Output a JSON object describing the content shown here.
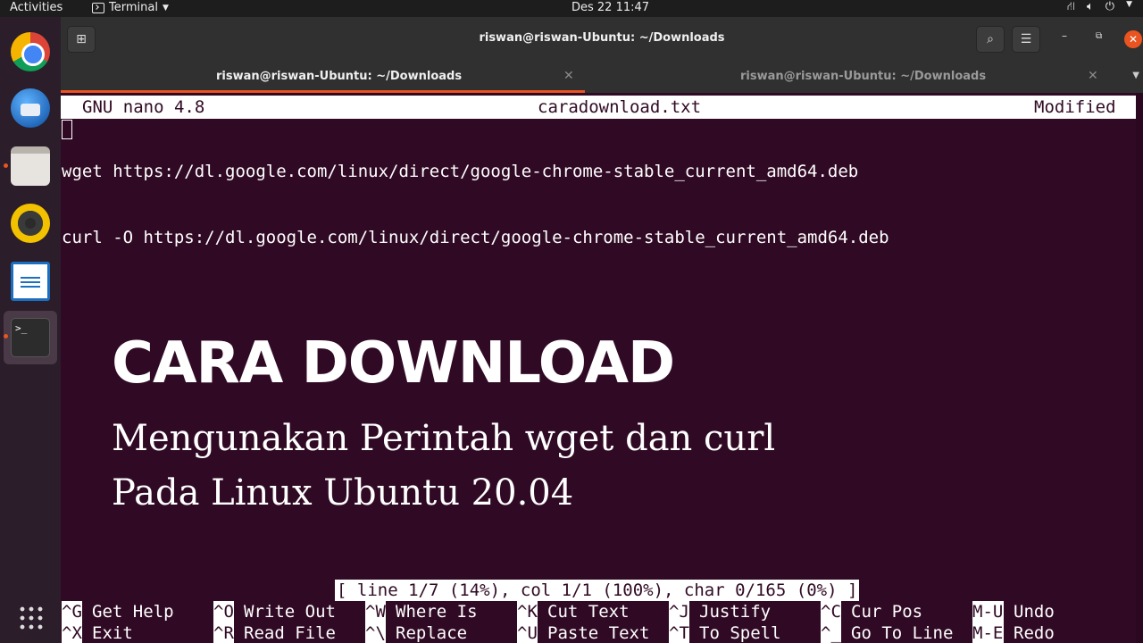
{
  "topbar": {
    "activities": "Activities",
    "app_menu": "Terminal",
    "clock": "Des 22  11:47",
    "tray_icons": [
      "network-icon",
      "volume-icon",
      "power-icon",
      "menu-caret-icon"
    ]
  },
  "dock": {
    "apps": [
      "chrome-icon",
      "thunderbird-icon",
      "files-icon",
      "rhythmbox-icon",
      "writer-icon",
      "terminal-icon"
    ],
    "terminal_glyph": ">_"
  },
  "window": {
    "title": "riswan@riswan-Ubuntu: ~/Downloads",
    "tabs": [
      {
        "label": "riswan@riswan-Ubuntu: ~/Downloads",
        "active": true
      },
      {
        "label": "riswan@riswan-Ubuntu: ~/Downloads",
        "active": false
      }
    ]
  },
  "nano": {
    "version": "GNU nano 4.8",
    "filename": "caradownload.txt",
    "state": "Modified",
    "lines": [
      "wget https://dl.google.com/linux/direct/google-chrome-stable_current_amd64.deb",
      "curl -O https://dl.google.com/linux/direct/google-chrome-stable_current_amd64.deb"
    ],
    "status": "[ line 1/7 (14%), col 1/1 (100%), char 0/165 (0%) ]",
    "shortcuts_row1": [
      {
        "key": "^G",
        "label": "Get Help"
      },
      {
        "key": "^O",
        "label": "Write Out"
      },
      {
        "key": "^W",
        "label": "Where Is"
      },
      {
        "key": "^K",
        "label": "Cut Text"
      },
      {
        "key": "^J",
        "label": "Justify"
      },
      {
        "key": "^C",
        "label": "Cur Pos"
      },
      {
        "key": "M-U",
        "label": "Undo"
      }
    ],
    "shortcuts_row2": [
      {
        "key": "^X",
        "label": "Exit"
      },
      {
        "key": "^R",
        "label": "Read File"
      },
      {
        "key": "^\\",
        "label": "Replace"
      },
      {
        "key": "^U",
        "label": "Paste Text"
      },
      {
        "key": "^T",
        "label": "To Spell"
      },
      {
        "key": "^_",
        "label": "Go To Line"
      },
      {
        "key": "M-E",
        "label": "Redo"
      }
    ]
  },
  "overlay": {
    "headline": "CARA DOWNLOAD",
    "sub1": "Mengunakan Perintah wget dan curl",
    "sub2": "Pada Linux Ubuntu 20.04"
  },
  "colors": {
    "terminal_bg": "#300a24",
    "accent": "#e95420"
  }
}
